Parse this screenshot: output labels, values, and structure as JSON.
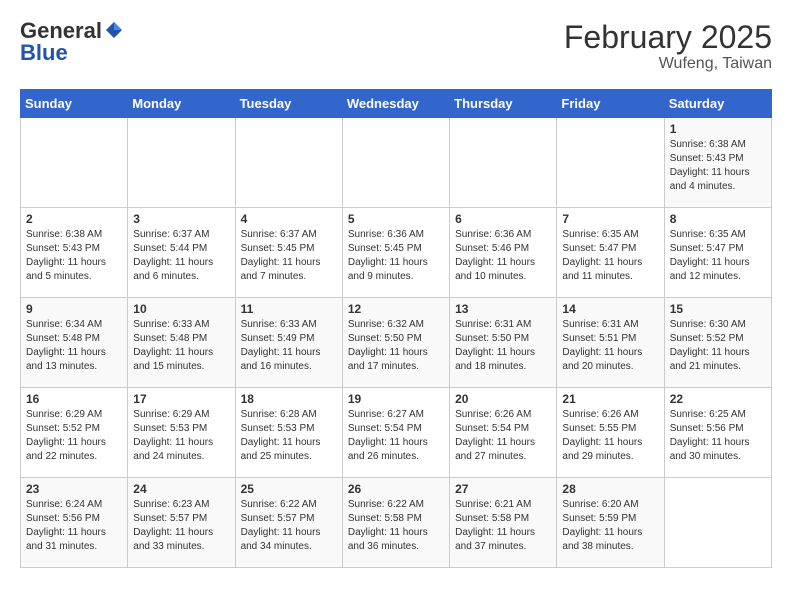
{
  "header": {
    "logo_general": "General",
    "logo_blue": "Blue",
    "month_title": "February 2025",
    "location": "Wufeng, Taiwan"
  },
  "days_of_week": [
    "Sunday",
    "Monday",
    "Tuesday",
    "Wednesday",
    "Thursday",
    "Friday",
    "Saturday"
  ],
  "weeks": [
    [
      {
        "day": "",
        "info": ""
      },
      {
        "day": "",
        "info": ""
      },
      {
        "day": "",
        "info": ""
      },
      {
        "day": "",
        "info": ""
      },
      {
        "day": "",
        "info": ""
      },
      {
        "day": "",
        "info": ""
      },
      {
        "day": "1",
        "info": "Sunrise: 6:38 AM\nSunset: 5:43 PM\nDaylight: 11 hours and 4 minutes."
      }
    ],
    [
      {
        "day": "2",
        "info": "Sunrise: 6:38 AM\nSunset: 5:43 PM\nDaylight: 11 hours and 5 minutes."
      },
      {
        "day": "3",
        "info": "Sunrise: 6:37 AM\nSunset: 5:44 PM\nDaylight: 11 hours and 6 minutes."
      },
      {
        "day": "4",
        "info": "Sunrise: 6:37 AM\nSunset: 5:45 PM\nDaylight: 11 hours and 7 minutes."
      },
      {
        "day": "5",
        "info": "Sunrise: 6:36 AM\nSunset: 5:45 PM\nDaylight: 11 hours and 9 minutes."
      },
      {
        "day": "6",
        "info": "Sunrise: 6:36 AM\nSunset: 5:46 PM\nDaylight: 11 hours and 10 minutes."
      },
      {
        "day": "7",
        "info": "Sunrise: 6:35 AM\nSunset: 5:47 PM\nDaylight: 11 hours and 11 minutes."
      },
      {
        "day": "8",
        "info": "Sunrise: 6:35 AM\nSunset: 5:47 PM\nDaylight: 11 hours and 12 minutes."
      }
    ],
    [
      {
        "day": "9",
        "info": "Sunrise: 6:34 AM\nSunset: 5:48 PM\nDaylight: 11 hours and 13 minutes."
      },
      {
        "day": "10",
        "info": "Sunrise: 6:33 AM\nSunset: 5:48 PM\nDaylight: 11 hours and 15 minutes."
      },
      {
        "day": "11",
        "info": "Sunrise: 6:33 AM\nSunset: 5:49 PM\nDaylight: 11 hours and 16 minutes."
      },
      {
        "day": "12",
        "info": "Sunrise: 6:32 AM\nSunset: 5:50 PM\nDaylight: 11 hours and 17 minutes."
      },
      {
        "day": "13",
        "info": "Sunrise: 6:31 AM\nSunset: 5:50 PM\nDaylight: 11 hours and 18 minutes."
      },
      {
        "day": "14",
        "info": "Sunrise: 6:31 AM\nSunset: 5:51 PM\nDaylight: 11 hours and 20 minutes."
      },
      {
        "day": "15",
        "info": "Sunrise: 6:30 AM\nSunset: 5:52 PM\nDaylight: 11 hours and 21 minutes."
      }
    ],
    [
      {
        "day": "16",
        "info": "Sunrise: 6:29 AM\nSunset: 5:52 PM\nDaylight: 11 hours and 22 minutes."
      },
      {
        "day": "17",
        "info": "Sunrise: 6:29 AM\nSunset: 5:53 PM\nDaylight: 11 hours and 24 minutes."
      },
      {
        "day": "18",
        "info": "Sunrise: 6:28 AM\nSunset: 5:53 PM\nDaylight: 11 hours and 25 minutes."
      },
      {
        "day": "19",
        "info": "Sunrise: 6:27 AM\nSunset: 5:54 PM\nDaylight: 11 hours and 26 minutes."
      },
      {
        "day": "20",
        "info": "Sunrise: 6:26 AM\nSunset: 5:54 PM\nDaylight: 11 hours and 27 minutes."
      },
      {
        "day": "21",
        "info": "Sunrise: 6:26 AM\nSunset: 5:55 PM\nDaylight: 11 hours and 29 minutes."
      },
      {
        "day": "22",
        "info": "Sunrise: 6:25 AM\nSunset: 5:56 PM\nDaylight: 11 hours and 30 minutes."
      }
    ],
    [
      {
        "day": "23",
        "info": "Sunrise: 6:24 AM\nSunset: 5:56 PM\nDaylight: 11 hours and 31 minutes."
      },
      {
        "day": "24",
        "info": "Sunrise: 6:23 AM\nSunset: 5:57 PM\nDaylight: 11 hours and 33 minutes."
      },
      {
        "day": "25",
        "info": "Sunrise: 6:22 AM\nSunset: 5:57 PM\nDaylight: 11 hours and 34 minutes."
      },
      {
        "day": "26",
        "info": "Sunrise: 6:22 AM\nSunset: 5:58 PM\nDaylight: 11 hours and 36 minutes."
      },
      {
        "day": "27",
        "info": "Sunrise: 6:21 AM\nSunset: 5:58 PM\nDaylight: 11 hours and 37 minutes."
      },
      {
        "day": "28",
        "info": "Sunrise: 6:20 AM\nSunset: 5:59 PM\nDaylight: 11 hours and 38 minutes."
      },
      {
        "day": "",
        "info": ""
      }
    ]
  ]
}
